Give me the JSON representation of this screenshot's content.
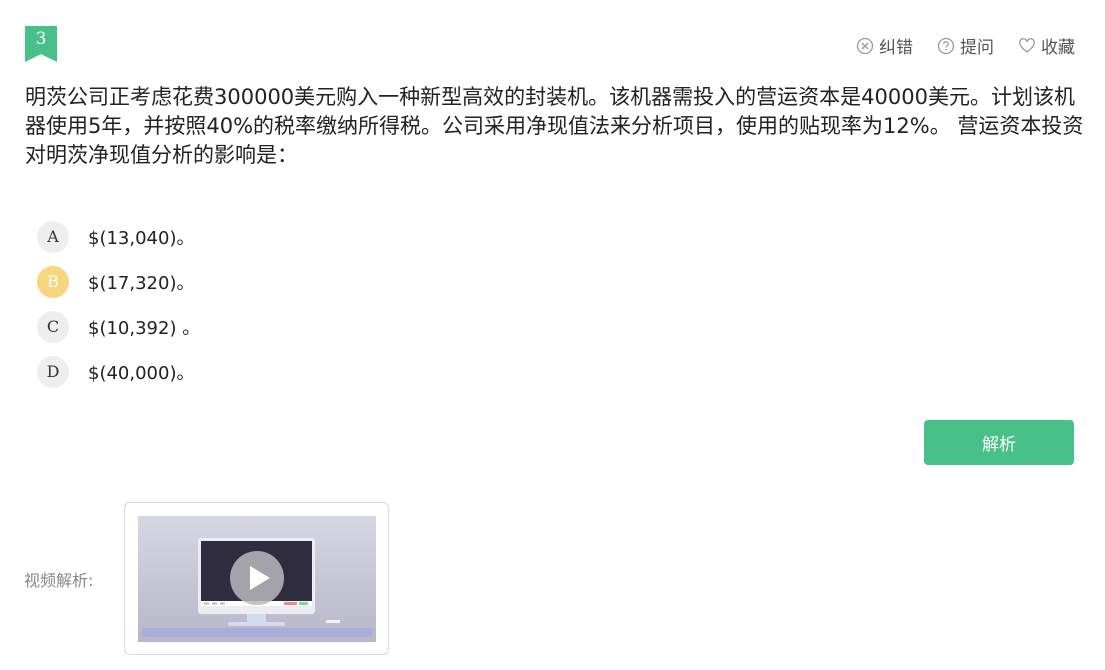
{
  "question": {
    "number": "3",
    "text": "明茨公司正考虑花费300000美元购入一种新型高效的封装机。该机器需投入的营运资本是40000美元。计划该机器使用5年，并按照40%的税率缴纳所得税。公司采用净现值法来分析项目，使用的贴现率为12%。 营运资本投资对明茨净现值分析的影响是：",
    "options": [
      {
        "letter": "A",
        "text": "$(13,040)。",
        "selected": false
      },
      {
        "letter": "B",
        "text": "$(17,320)。",
        "selected": true
      },
      {
        "letter": "C",
        "text": "$(10,392) 。",
        "selected": false
      },
      {
        "letter": "D",
        "text": "$(40,000)。",
        "selected": false
      }
    ]
  },
  "toolbar": {
    "report_label": "纠错",
    "ask_label": "提问",
    "favorite_label": "收藏"
  },
  "analysis_button_label": "解析",
  "video": {
    "label": "视频解析:"
  },
  "colors": {
    "accent": "#48c08a",
    "selected_option": "#f8d67e"
  }
}
